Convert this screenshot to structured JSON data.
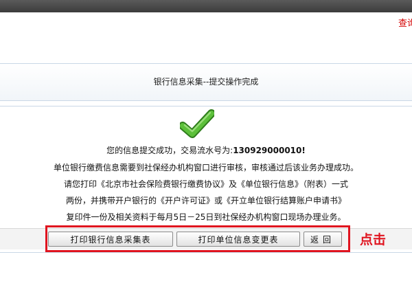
{
  "header": {
    "link_partial": "查询"
  },
  "title": "银行信息采集--提交操作完成",
  "result": {
    "success_prefix": "您的信息提交成功，交易流水号为:",
    "serial": "130929000010!",
    "line2": "单位银行缴费信息需要到社保经办机构窗口进行审核，审核通过后该业务办理成功。",
    "line3": "请您打印《北京市社会保险费银行缴费协议》及《单位银行信息》（附表）一式",
    "line4": "两份，并携带开户银行的《开户许可证》或《开立单位银行结算账户申请书》",
    "line5": "复印件一份及相关资料于每月5日－25日到社保经办机构窗口现场办理业务。"
  },
  "buttons": {
    "print_collection": "打印银行信息采集表",
    "print_change": "打印单位信息变更表",
    "back": "返回"
  },
  "annotation": {
    "text": "点击",
    "color": "#e0141f"
  },
  "colors": {
    "success_green": "#4aa52e",
    "border": "#c9d7e6",
    "link_red": "#d40000"
  },
  "icons": {
    "success": "checkmark-icon"
  }
}
